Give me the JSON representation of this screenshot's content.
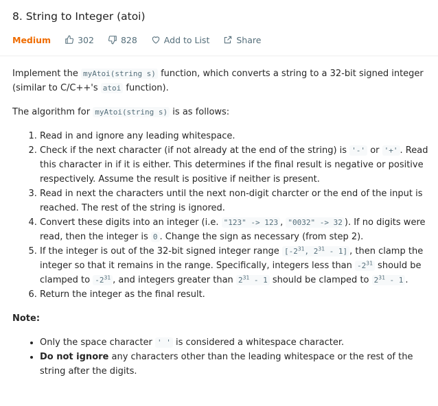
{
  "header": {
    "title": "8. String to Integer (atoi)",
    "difficulty": "Medium",
    "likes": "302",
    "dislikes": "828",
    "add_to_list": "Add to List",
    "share": "Share"
  },
  "colors": {
    "difficulty": "#ef6c00",
    "meta_text": "#546e7a",
    "code_text": "#546e7a",
    "code_bg": "#f7f9fa"
  },
  "description": {
    "intro": {
      "t1": "Implement the ",
      "c1": "myAtoi(string s)",
      "t2": " function, which converts a string to a 32-bit signed integer (similar to C/C++'s ",
      "c2": "atoi",
      "t3": " function)."
    },
    "algo_intro": {
      "t1": "The algorithm for ",
      "c1": "myAtoi(string s)",
      "t2": " is as follows:"
    },
    "steps": {
      "s1": "Read in and ignore any leading whitespace.",
      "s2_t1": "Check if the next character (if not already at the end of the string) is ",
      "s2_c1": "'-'",
      "s2_t2": " or ",
      "s2_c2": "'+'",
      "s2_t3": ". Read this character in if it is either. This determines if the final result is negative or positive respectively. Assume the result is positive if neither is present.",
      "s3": "Read in next the characters until the next non-digit charcter or the end of the input is reached. The rest of the string is ignored.",
      "s4_t1": "Convert these digits into an integer (i.e. ",
      "s4_c1": "\"123\" -> 123",
      "s4_t2": ", ",
      "s4_c2": "\"0032\" -> 32",
      "s4_t3": "). If no digits were read, then the integer is ",
      "s4_c3": "0",
      "s4_t4": ". Change the sign as necessary (from step 2).",
      "s5_t1": "If the integer is out of the 32-bit signed integer range ",
      "s5_c1a": "[-2",
      "s5_c1b": "31",
      "s5_c1c": ", 2",
      "s5_c1d": "31",
      "s5_c1e": " - 1]",
      "s5_t2": ", then clamp the integer so that it remains in the range. Specifically, integers less than ",
      "s5_c2a": "-2",
      "s5_c2b": "31",
      "s5_t3": " should be clamped to ",
      "s5_c3a": "-2",
      "s5_c3b": "31",
      "s5_t4": ", and integers greater than ",
      "s5_c4a": "2",
      "s5_c4b": "31",
      "s5_c4c": " - 1",
      "s5_t5": " should be clamped to ",
      "s5_c5a": "2",
      "s5_c5b": "31",
      "s5_c5c": " - 1",
      "s5_t6": ".",
      "s6": "Return the integer as the final result."
    },
    "note_label": "Note:",
    "notes": {
      "n1_t1": "Only the space character ",
      "n1_c1": "' '",
      "n1_t2": " is considered a whitespace character.",
      "n2_b": "Do not ignore",
      "n2_t1": " any characters other than the leading whitespace or the rest of the string after the digits."
    }
  }
}
